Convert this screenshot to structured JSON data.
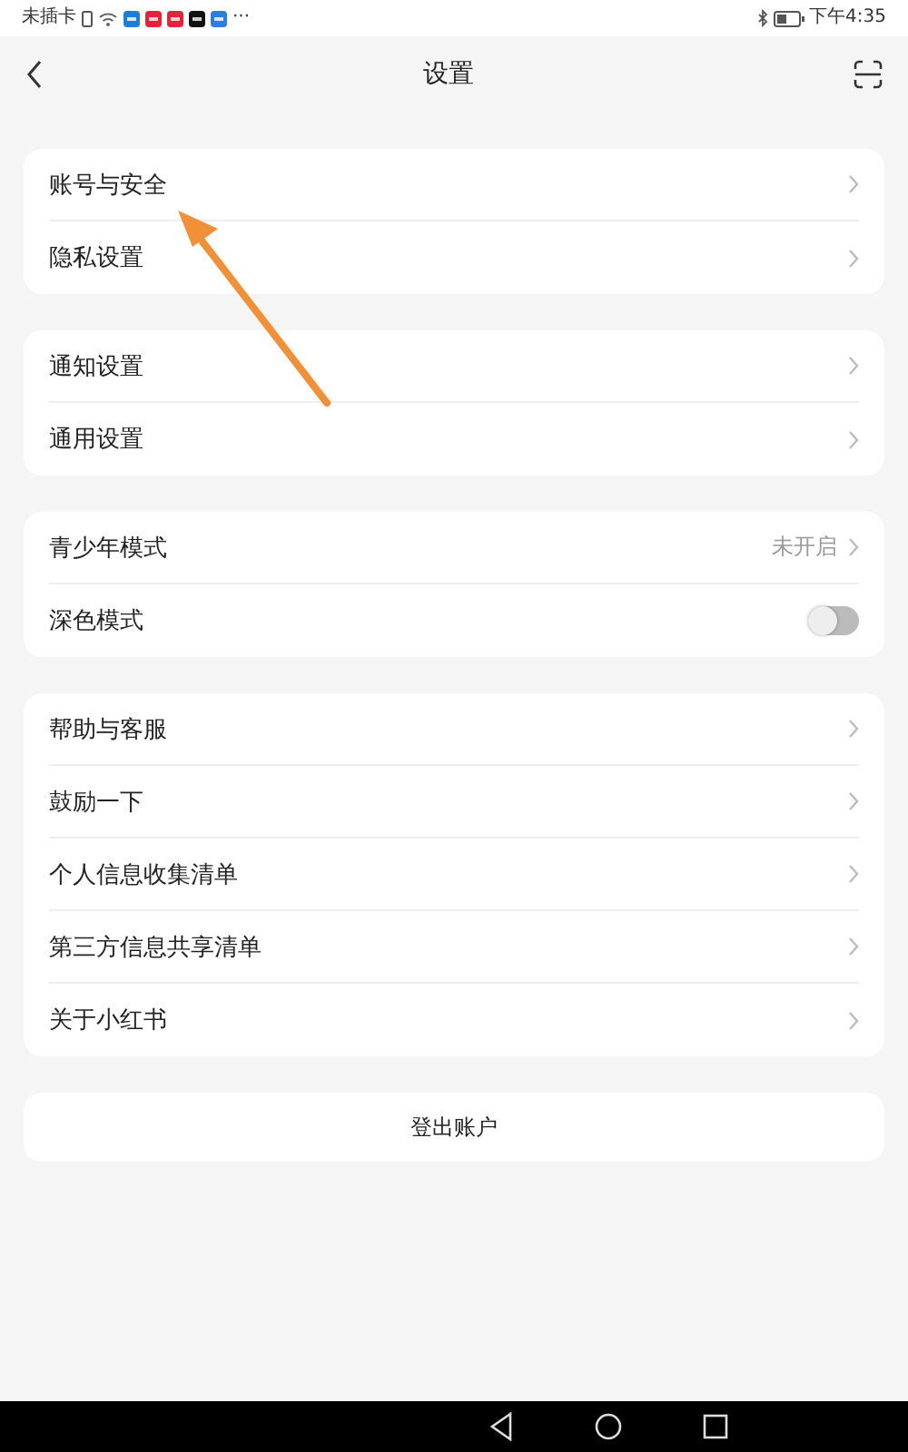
{
  "status_bar": {
    "carrier": "未插卡",
    "more": "···",
    "time": "下午4:35"
  },
  "header": {
    "title": "设置"
  },
  "groups": [
    {
      "items": [
        {
          "kind": "link",
          "label": "账号与安全"
        },
        {
          "kind": "link",
          "label": "隐私设置"
        }
      ]
    },
    {
      "items": [
        {
          "kind": "link",
          "label": "通知设置"
        },
        {
          "kind": "link",
          "label": "通用设置"
        }
      ]
    },
    {
      "items": [
        {
          "kind": "value",
          "label": "青少年模式",
          "value": "未开启"
        },
        {
          "kind": "toggle",
          "label": "深色模式",
          "on": false
        }
      ]
    },
    {
      "items": [
        {
          "kind": "link",
          "label": "帮助与客服"
        },
        {
          "kind": "link",
          "label": "鼓励一下"
        },
        {
          "kind": "link",
          "label": "个人信息收集清单"
        },
        {
          "kind": "link",
          "label": "第三方信息共享清单"
        },
        {
          "kind": "link",
          "label": "关于小红书"
        }
      ]
    }
  ],
  "logout_button": "登出账户"
}
